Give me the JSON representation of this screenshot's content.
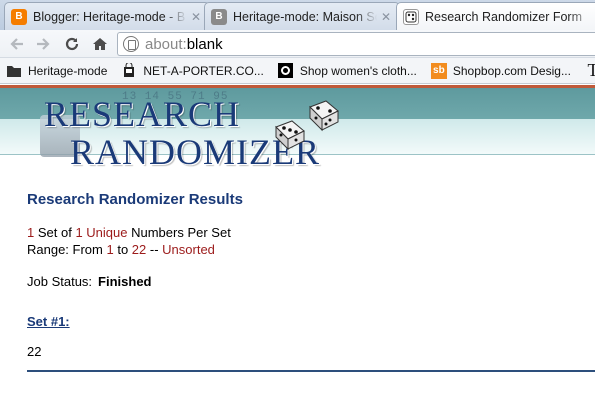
{
  "tabs": [
    {
      "title": "Blogger: Heritage-mode - B",
      "favicon": "blogger-icon",
      "color": "#f57d00",
      "active": false
    },
    {
      "title": "Heritage-mode: Maison Sco",
      "favicon": "blogger-grey-icon",
      "color": "#8a8a8a",
      "active": false
    },
    {
      "title": "Research Randomizer Form",
      "favicon": "dice-icon",
      "color": "#ffffff",
      "active": true
    }
  ],
  "toolbar": {
    "url_prefix": "about:",
    "url_rest": "blank"
  },
  "bookmarks": [
    {
      "label": "Heritage-mode",
      "icon": "folder-icon"
    },
    {
      "label": "NET-A-PORTER.CO...",
      "icon": "bag-icon"
    },
    {
      "label": "Shop women's cloth...",
      "icon": "circle-icon"
    },
    {
      "label": "Shopbop.com Desig...",
      "icon": "sb-icon",
      "icon_text": "sb"
    },
    {
      "label": "",
      "icon": "t-icon",
      "icon_text": "T"
    }
  ],
  "logo": {
    "line1": "RESEARCH",
    "line2": "RANDOMIZER",
    "digits": "13 14 55 71 95"
  },
  "results": {
    "title": "Research Randomizer Results",
    "sets_count": "1",
    "set_word": " Set of ",
    "numbers_count": "1",
    "unique_word": "Unique",
    "per_set": " Numbers Per Set",
    "range_label": "Range: From ",
    "range_from": "1",
    "range_to_word": " to ",
    "range_to": "22",
    "range_sep": " -- ",
    "sort_state": "Unsorted",
    "status_label": "Job Status:",
    "status_value": "Finished",
    "set_link": "Set #1:",
    "set_value": "22"
  }
}
